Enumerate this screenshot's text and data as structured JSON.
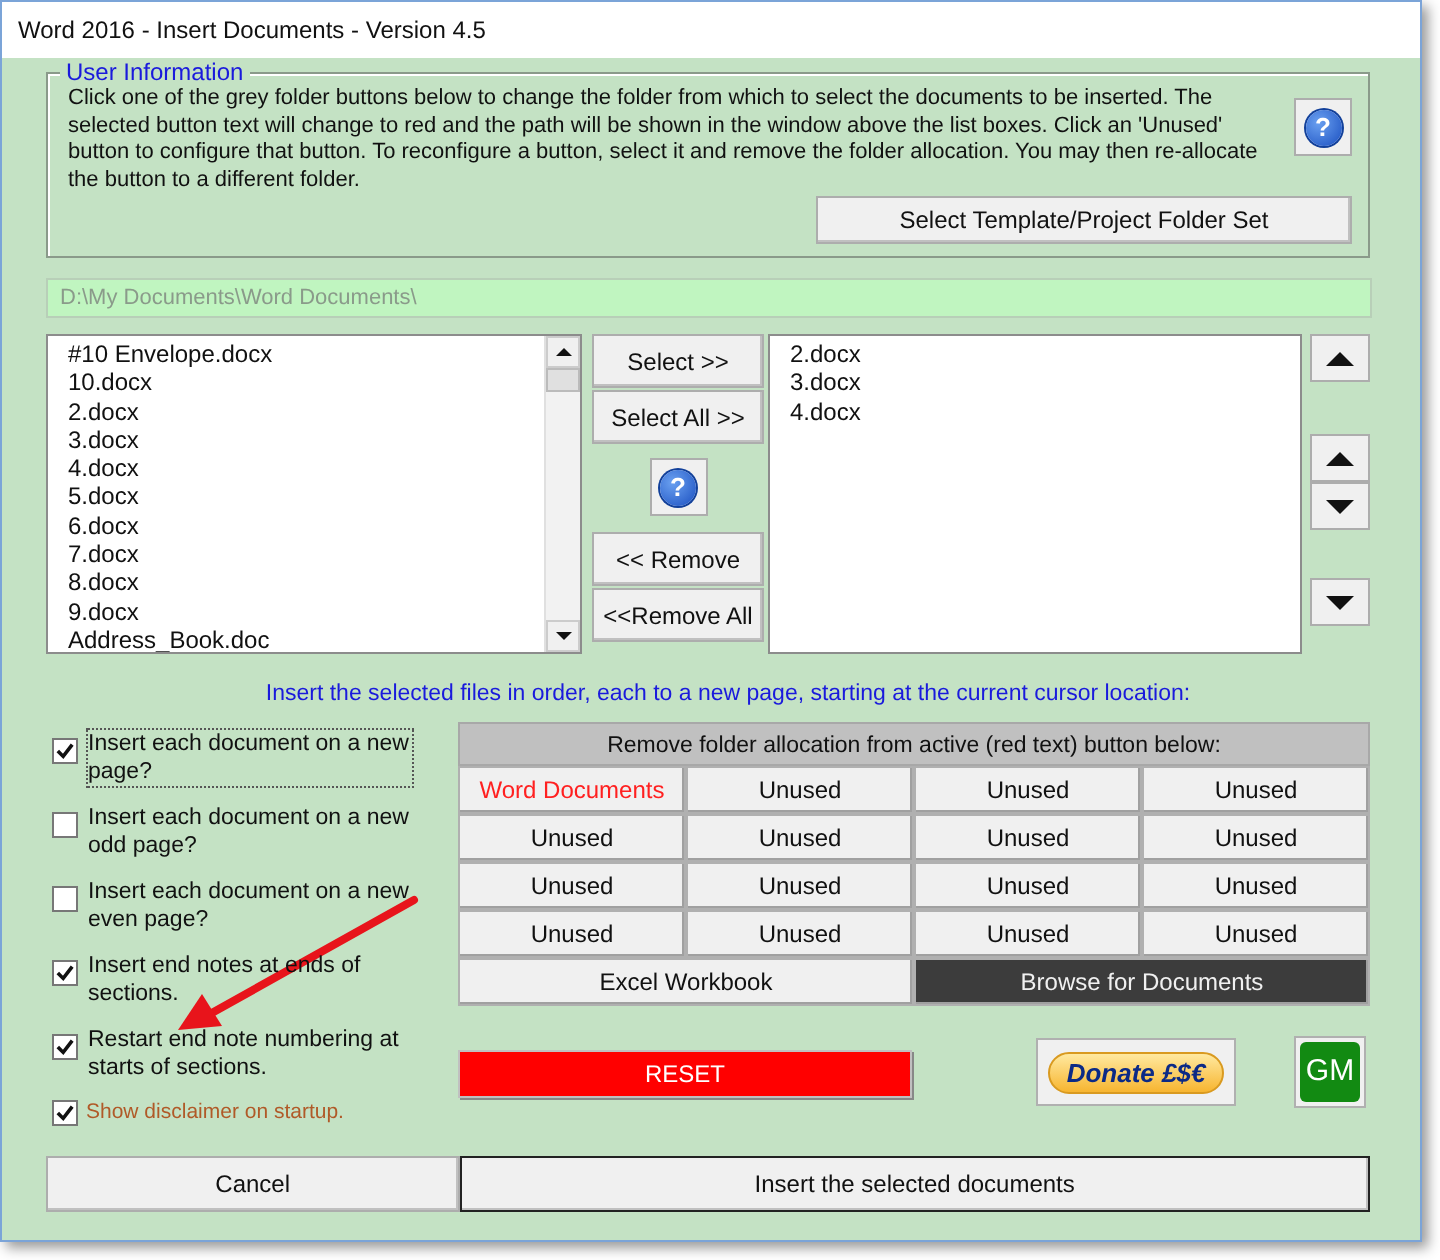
{
  "window": {
    "title": "Word 2016 - Insert Documents - Version 4.5"
  },
  "user_information": {
    "legend": "User Information",
    "text": "Click one of the grey folder buttons below to change the folder from which to select the documents to be inserted. The selected button text will change to red and the path will be shown in the window above the list boxes. Click an 'Unused' button to configure that button. To reconfigure a button, select it and remove the folder allocation. You may then re-allocate the button to a different folder.",
    "folder_set_button": "Select Template/Project Folder Set",
    "help_glyph": "?"
  },
  "path_field": {
    "value": "D:\\My Documents\\Word Documents\\"
  },
  "available_files": [
    "#10 Envelope.docx",
    "10.docx",
    "2.docx",
    "3.docx",
    "4.docx",
    "5.docx",
    "6.docx",
    "7.docx",
    "8.docx",
    "9.docx",
    "Address_Book.doc"
  ],
  "transfer_buttons": {
    "select": "Select >>",
    "select_all": "Select All >>",
    "remove": "<< Remove",
    "remove_all": "<<Remove All",
    "help_glyph": "?"
  },
  "selected_files": [
    "2.docx",
    "3.docx",
    "4.docx"
  ],
  "instruction": "Insert the selected files in order, each to a new page, starting at the current cursor location:",
  "options": [
    {
      "label": "Insert each document on a new page?",
      "checked": true,
      "focused": true
    },
    {
      "label": "Insert each document on a new odd page?",
      "checked": false,
      "focused": false
    },
    {
      "label": "Insert each document on a new even page?",
      "checked": false,
      "focused": false
    },
    {
      "label": "Insert end notes at ends of sections.",
      "checked": true,
      "focused": false
    },
    {
      "label": "Restart end note numbering at starts of sections.",
      "checked": true,
      "focused": false
    }
  ],
  "disclaimer": {
    "label": "Show disclaimer on startup.",
    "checked": true
  },
  "folder_grid": {
    "header": "Remove folder allocation from active (red text) button below:",
    "buttons": [
      {
        "label": "Word Documents",
        "active": true
      },
      {
        "label": "Unused",
        "active": false
      },
      {
        "label": "Unused",
        "active": false
      },
      {
        "label": "Unused",
        "active": false
      },
      {
        "label": "Unused",
        "active": false
      },
      {
        "label": "Unused",
        "active": false
      },
      {
        "label": "Unused",
        "active": false
      },
      {
        "label": "Unused",
        "active": false
      },
      {
        "label": "Unused",
        "active": false
      },
      {
        "label": "Unused",
        "active": false
      },
      {
        "label": "Unused",
        "active": false
      },
      {
        "label": "Unused",
        "active": false
      },
      {
        "label": "Unused",
        "active": false
      },
      {
        "label": "Unused",
        "active": false
      },
      {
        "label": "Unused",
        "active": false
      },
      {
        "label": "Unused",
        "active": false
      }
    ],
    "bottom_buttons": [
      {
        "label": "Excel Workbook",
        "dark": false
      },
      {
        "label": "Browse for Documents",
        "dark": true
      }
    ]
  },
  "reset_button": "RESET",
  "donate_button": "Donate £$€",
  "gm_button": "GM",
  "cancel_button": "Cancel",
  "insert_button": "Insert the selected documents"
}
